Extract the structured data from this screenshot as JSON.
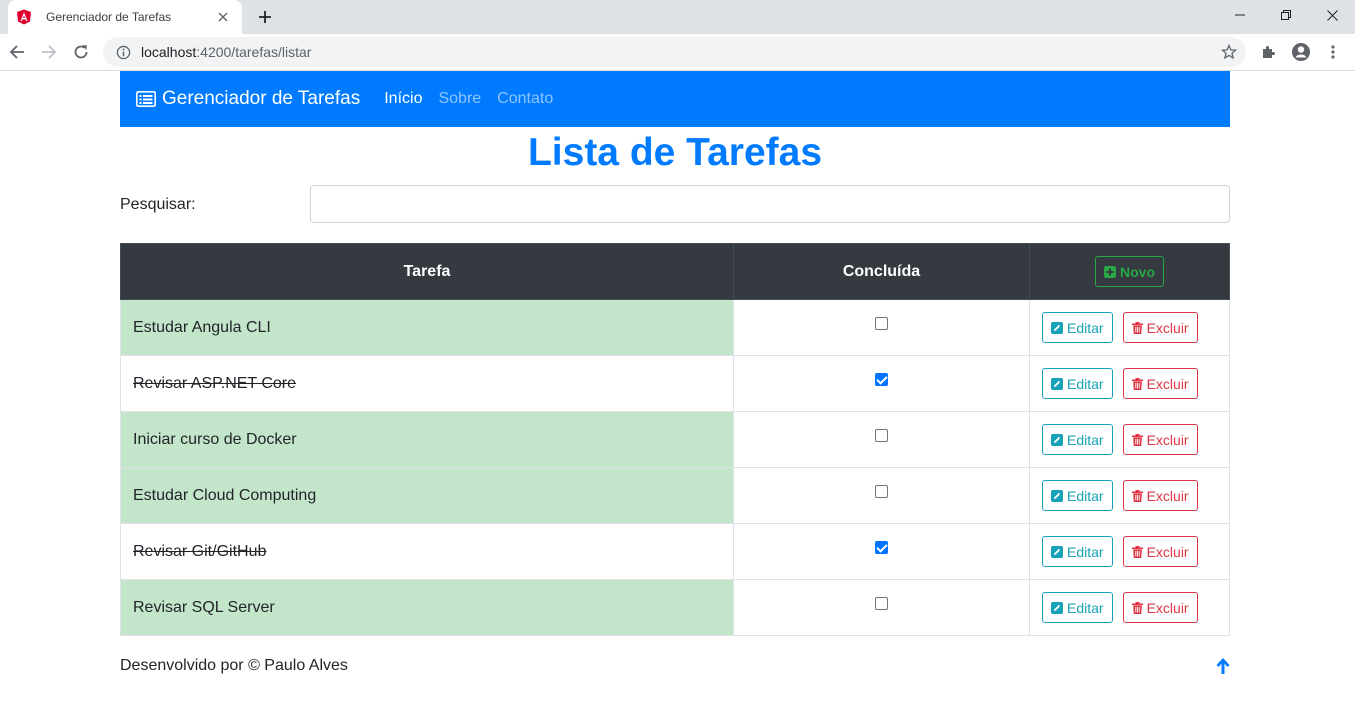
{
  "browser": {
    "tab_title": "Gerenciador de Tarefas",
    "url_host": "localhost",
    "url_path": ":4200/tarefas/listar"
  },
  "navbar": {
    "brand": "Gerenciador de Tarefas",
    "links": [
      "Início",
      "Sobre",
      "Contato"
    ]
  },
  "page": {
    "title": "Lista de Tarefas",
    "search_label": "Pesquisar:",
    "search_value": ""
  },
  "table": {
    "headers": [
      "Tarefa",
      "Concluída"
    ],
    "new_button": "Novo",
    "edit_label": "Editar",
    "delete_label": "Excluir",
    "rows": [
      {
        "name": "Estudar Angula CLI",
        "done": false
      },
      {
        "name": "Revisar ASP.NET Core",
        "done": true
      },
      {
        "name": "Iniciar curso de Docker",
        "done": false
      },
      {
        "name": "Estudar Cloud Computing",
        "done": false
      },
      {
        "name": "Revisar Git/GitHub",
        "done": true
      },
      {
        "name": "Revisar SQL Server",
        "done": false
      }
    ]
  },
  "footer": {
    "text": "Desenvolvido por © Paulo Alves"
  },
  "colors": {
    "primary": "#007bff",
    "pending_row": "#c3e6cb",
    "header_dark": "#343a40",
    "info": "#17a2b8",
    "danger": "#dc3545",
    "success": "#28a745"
  }
}
